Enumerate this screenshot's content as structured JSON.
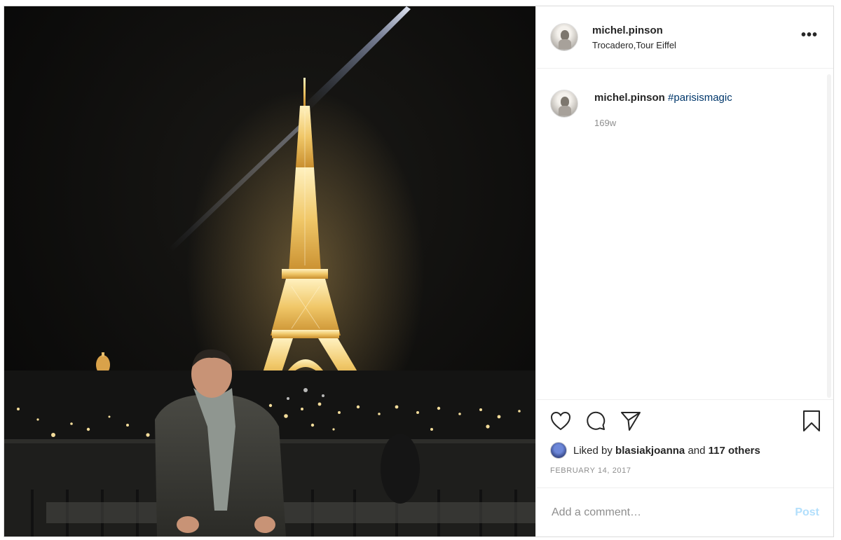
{
  "post": {
    "username": "michel.pinson",
    "location": "Trocadero,Tour Eiffel",
    "more_icon": "more-options-icon"
  },
  "caption": {
    "username": "michel.pinson",
    "hashtag": "#parisismagic",
    "age": "169w"
  },
  "actions": {
    "like_icon": "heart-icon",
    "comment_icon": "comment-icon",
    "share_icon": "paper-plane-icon",
    "save_icon": "bookmark-icon"
  },
  "likes": {
    "prefix": "Liked by",
    "user": "blasiakjoanna",
    "middle": "and",
    "others": "117 others"
  },
  "date": "FEBRUARY 14, 2017",
  "comment_box": {
    "placeholder": "Add a comment…",
    "post_label": "Post"
  },
  "colors": {
    "hashtag": "#00376b",
    "post_button": "#b2dffc",
    "muted": "#8e8e8e"
  }
}
